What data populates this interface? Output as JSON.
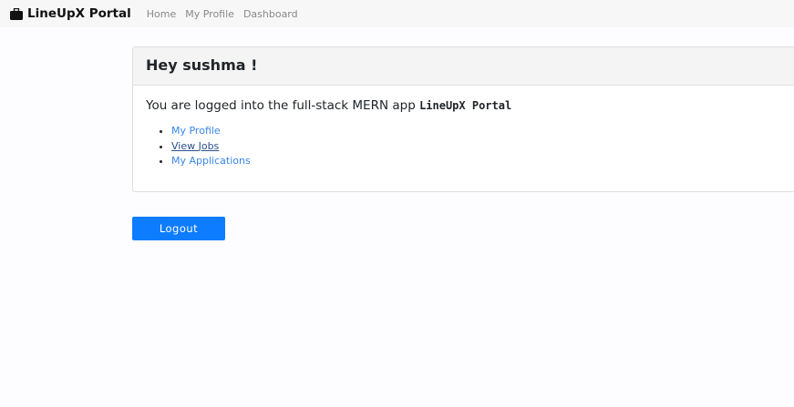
{
  "navbar": {
    "brand": "LineUpX Portal",
    "links": [
      "Home",
      "My Profile",
      "Dashboard"
    ]
  },
  "card": {
    "title": "Hey sushma !",
    "lead": "You are logged into the full-stack MERN app ",
    "app_name": "LineUpX Portal",
    "links": [
      "My Profile",
      "View Jobs",
      "My Applications"
    ]
  },
  "logout_label": "Logout"
}
